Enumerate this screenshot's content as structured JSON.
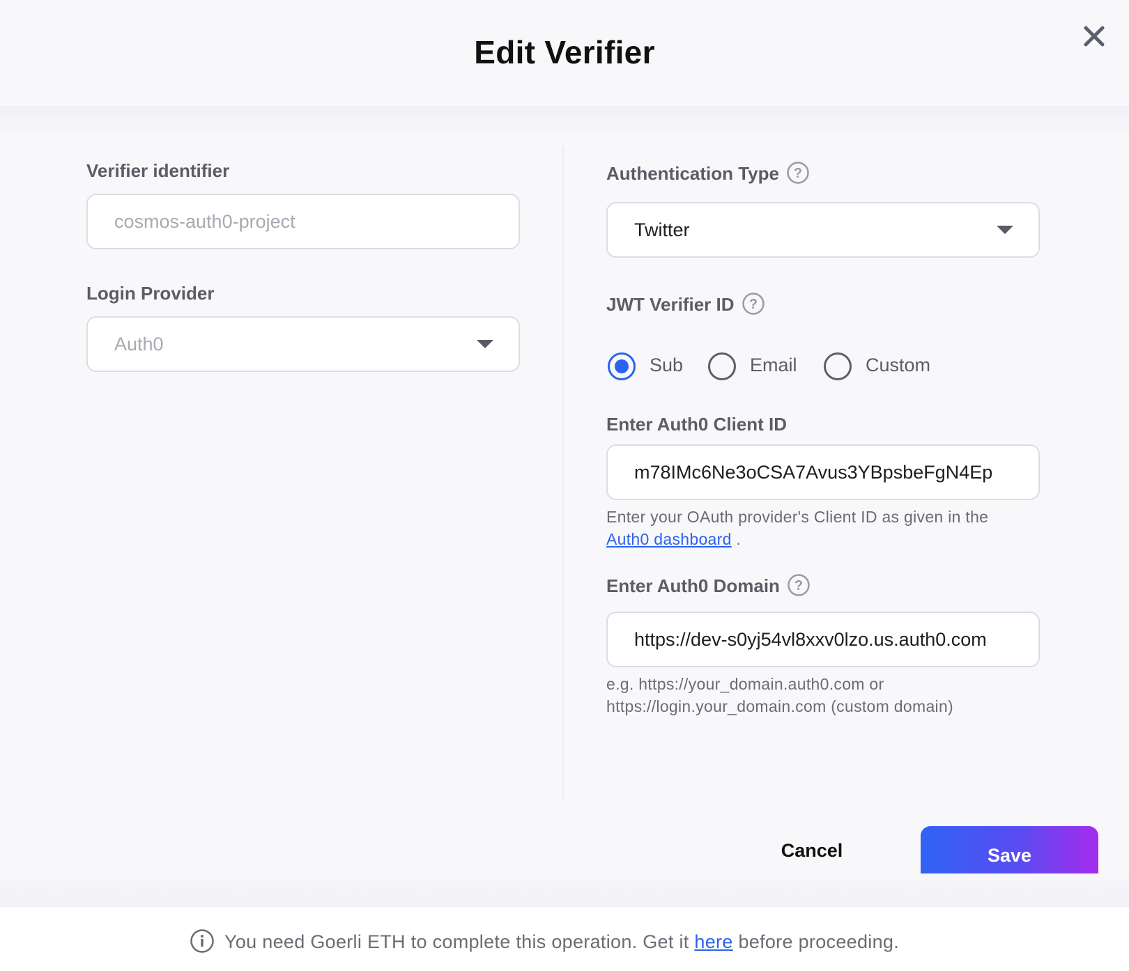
{
  "modal": {
    "title": "Edit Verifier"
  },
  "left": {
    "verifier_identifier": {
      "label": "Verifier identifier",
      "placeholder": "cosmos-auth0-project"
    },
    "login_provider": {
      "label": "Login Provider",
      "value": "Auth0"
    }
  },
  "right": {
    "authentication_type": {
      "label": "Authentication Type",
      "value": "Twitter"
    },
    "jwt_verifier_id": {
      "label": "JWT Verifier ID",
      "options": [
        {
          "label": "Sub",
          "checked": true
        },
        {
          "label": "Email",
          "checked": false
        },
        {
          "label": "Custom",
          "checked": false
        }
      ]
    },
    "client_id": {
      "label": "Enter Auth0 Client ID",
      "value": "m78IMc6Ne3oCSA7Avus3YBpsbeFgN4Ep",
      "hint_text": "Enter your OAuth provider's Client ID as given in the",
      "hint_link": "Auth0 dashboard",
      "hint_suffix": "."
    },
    "domain": {
      "label": "Enter Auth0 Domain",
      "value": "https://dev-s0yj54vl8xxv0lzo.us.auth0.com",
      "hint_line1": "e.g. https://your_domain.auth0.com or",
      "hint_line2": "https://login.your_domain.com (custom domain)"
    }
  },
  "actions": {
    "cancel_label": "Cancel",
    "save_label": "Save"
  },
  "footer": {
    "text_before": "You need Goerli ETH to complete this operation. Get it",
    "link": "here",
    "text_after": "before proceeding."
  },
  "colors": {
    "accent": "#2b62f0",
    "save_gradient_start": "#2f63f5",
    "save_gradient_end": "#a52cee",
    "background": "#f8f8fb",
    "label": "#5c5c66"
  }
}
